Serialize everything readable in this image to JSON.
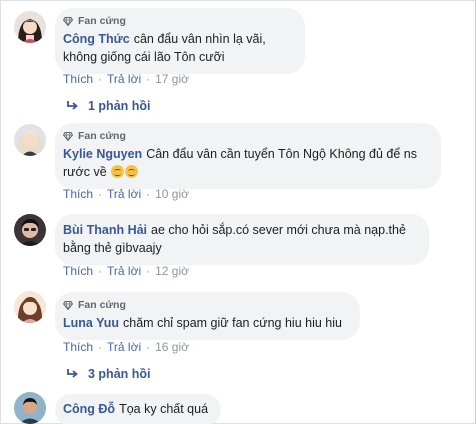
{
  "comments": [
    {
      "badge": "Fan cứng",
      "author": "Công Thức",
      "text": "cân đẩu vân nhìn lạ vãi, không giống cái lão Tôn cưỡi",
      "like_label": "Thích",
      "reply_label": "Trả lời",
      "time": "17 giờ",
      "replies": "1 phản hồi"
    },
    {
      "badge": "Fan cứng",
      "author": "Kylie Nguyen",
      "text": "Cân đẩu vân cần tuyển Tôn Ngộ Không đủ để ns rước về",
      "emojis": [
        "grinning-face-emoji",
        "grinning-face-emoji"
      ],
      "like_label": "Thích",
      "reply_label": "Trả lời",
      "time": "10 giờ"
    },
    {
      "author": "Bùi Thanh Hải",
      "text": "ae cho hỏi sắp.có sever mới chưa mà nạp.thẻ bằng thẻ gìbvaajy",
      "like_label": "Thích",
      "reply_label": "Trả lời",
      "time": "12 giờ"
    },
    {
      "badge": "Fan cứng",
      "author": "Luna Yuu",
      "text": "chăm chỉ spam giữ fan cứng hiu hiu hiu",
      "like_label": "Thích",
      "reply_label": "Trả lời",
      "time": "16 giờ",
      "replies": "3 phản hồi"
    },
    {
      "author": "Công Đỗ",
      "text": "Tọa ky chất quá"
    }
  ],
  "colors": {
    "author": "#385898",
    "link": "#4267b2",
    "muted": "#90949c",
    "bubble": "#f2f3f5"
  }
}
